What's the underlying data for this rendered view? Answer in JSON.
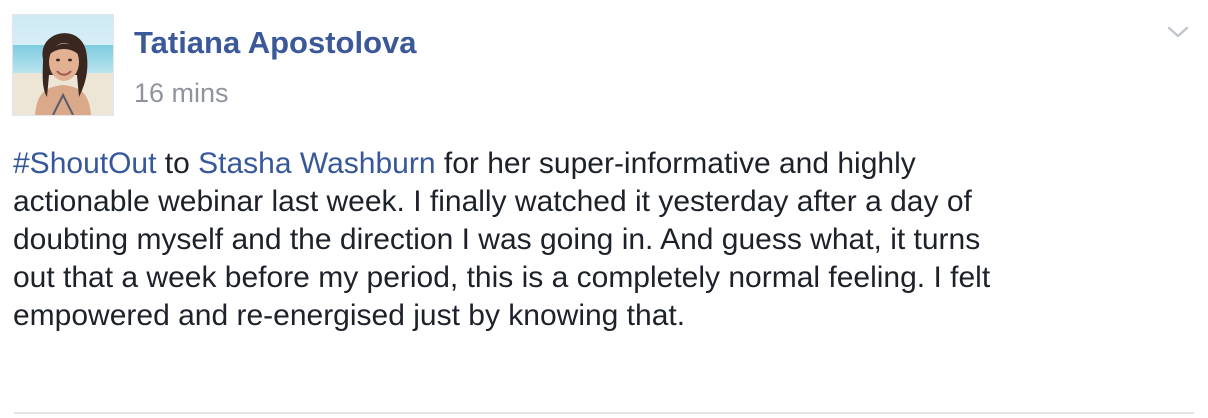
{
  "post": {
    "author": "Tatiana Apostolova",
    "timestamp": "16 mins",
    "options_icon": "chevron-down-icon",
    "body": {
      "hashtag": "#ShoutOut",
      "to_word": "to",
      "mention": "Stasha Washburn",
      "line1_rest": "for her super-informative and highly",
      "line2": "actionable webinar last week. I finally watched it yesterday after a day of",
      "line3": "doubting myself and the direction I was going in. And guess what, it turns",
      "line4": "out that a week before my period, this is a completely normal feeling. I felt",
      "line5": "empowered and re-energised just by knowing that."
    }
  },
  "colors": {
    "author": "#3b5998",
    "link": "#365899",
    "timestamp": "#90949c",
    "text": "#1d2129"
  }
}
